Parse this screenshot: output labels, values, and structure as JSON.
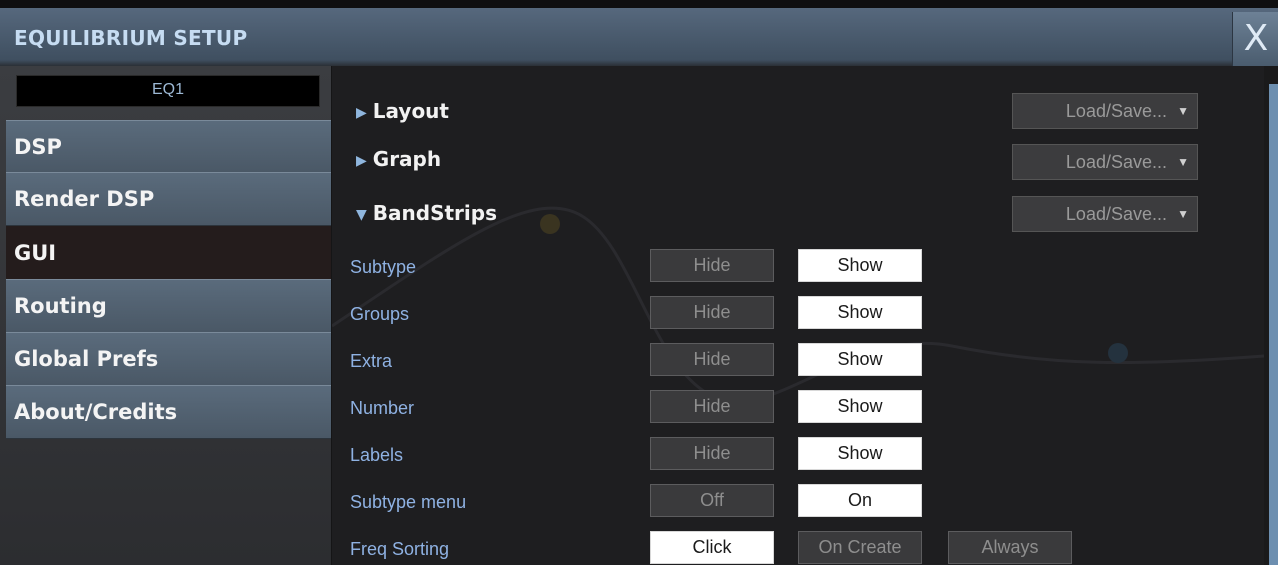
{
  "window": {
    "title": "EQUILIBRIUM SETUP",
    "close_label": "X"
  },
  "sidebar": {
    "preset": "EQ1",
    "items": [
      {
        "label": "DSP",
        "active": false
      },
      {
        "label": "Render DSP",
        "active": false
      },
      {
        "label": "GUI",
        "active": true
      },
      {
        "label": "Routing",
        "active": false
      },
      {
        "label": "Global Prefs",
        "active": false
      },
      {
        "label": "About/Credits",
        "active": false
      }
    ]
  },
  "sections": [
    {
      "label": "Layout",
      "expanded": false,
      "menu": "Load/Save..."
    },
    {
      "label": "Graph",
      "expanded": false,
      "menu": "Load/Save..."
    },
    {
      "label": "BandStrips",
      "expanded": true,
      "menu": "Load/Save..."
    }
  ],
  "bandstrips": {
    "rows": [
      {
        "label": "Subtype",
        "options": [
          "Hide",
          "Show"
        ],
        "selected": "Show"
      },
      {
        "label": "Groups",
        "options": [
          "Hide",
          "Show"
        ],
        "selected": "Show"
      },
      {
        "label": "Extra",
        "options": [
          "Hide",
          "Show"
        ],
        "selected": "Show"
      },
      {
        "label": "Number",
        "options": [
          "Hide",
          "Show"
        ],
        "selected": "Show"
      },
      {
        "label": "Labels",
        "options": [
          "Hide",
          "Show"
        ],
        "selected": "Show"
      },
      {
        "label": "Subtype menu",
        "options": [
          "Off",
          "On"
        ],
        "selected": "On"
      },
      {
        "label": "Freq Sorting",
        "options": [
          "Click",
          "On Create",
          "Always"
        ],
        "selected": "Click"
      }
    ]
  },
  "colors": {
    "accent": "#8fb2e3",
    "titlebar": "#4f6276",
    "nav": "#536373",
    "nav_active": "#241c1c"
  }
}
